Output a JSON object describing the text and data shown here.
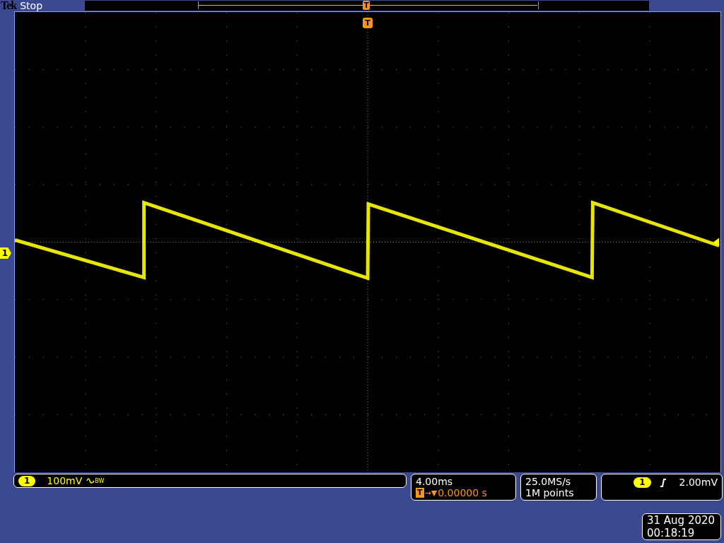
{
  "header": {
    "brand": "Tek",
    "run_state": "Stop",
    "trigger_marker": "T"
  },
  "display": {
    "trigger_marker": "T",
    "channel_marker": "1"
  },
  "channel": {
    "number": "1",
    "scale": "100mV",
    "bandwidth_mark": "BW"
  },
  "horizontal": {
    "scale": "4.00ms",
    "trigger_marker": "T",
    "delay_arrow": "→▼",
    "position": "0.00000 s"
  },
  "acquisition": {
    "sample_rate": "25.0MS/s",
    "record_length": "1M points"
  },
  "trigger": {
    "source": "1",
    "level": "2.00mV"
  },
  "clock": {
    "date": "31 Aug 2020",
    "time": "00:18:19"
  }
}
